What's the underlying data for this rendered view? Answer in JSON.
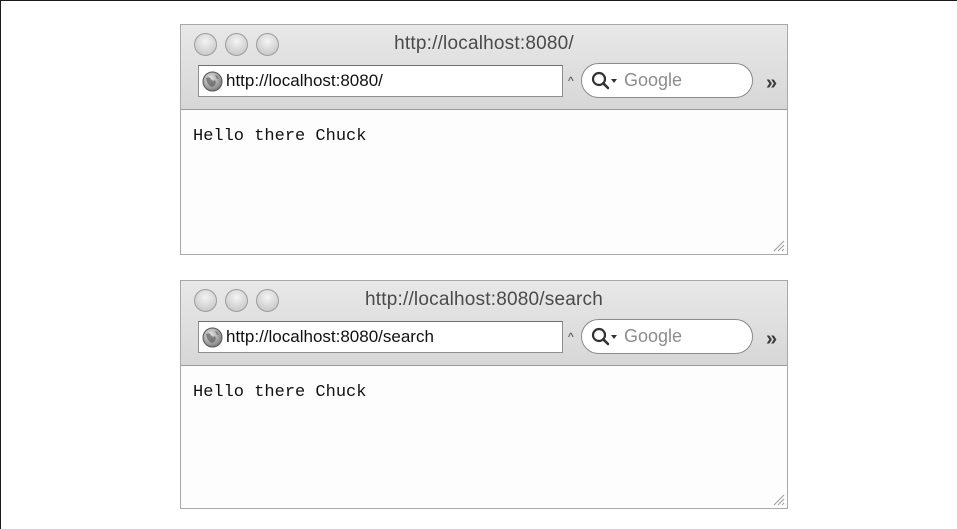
{
  "windows": [
    {
      "title": "http://localhost:8080/",
      "url": "http://localhost:8080/",
      "search_placeholder": "Google",
      "overflow_glyph": "»",
      "content": "Hello there Chuck"
    },
    {
      "title": "http://localhost:8080/search",
      "url": "http://localhost:8080/search",
      "search_placeholder": "Google",
      "overflow_glyph": "»",
      "content": "Hello there Chuck"
    }
  ],
  "icons": {
    "globe": "globe-icon",
    "search": "search-icon",
    "resize": "resize-grip-icon",
    "buttons": [
      "close-button",
      "minimize-button",
      "zoom-button"
    ]
  },
  "colors": {
    "chrome_top": "#e8e8e8",
    "chrome_bottom": "#d7d7d7",
    "border": "#a9a9a9",
    "content_bg": "#fdfdfd"
  }
}
